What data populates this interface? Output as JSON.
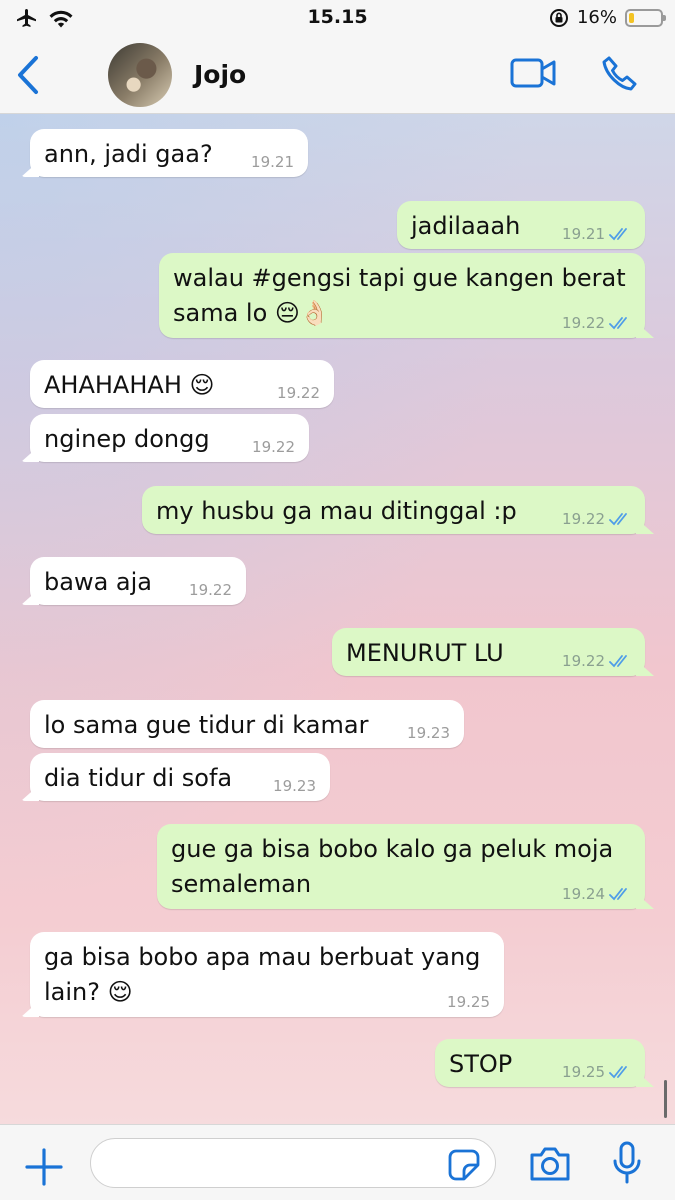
{
  "status_bar": {
    "time": "15.15",
    "battery_percent": "16%",
    "battery_level": 0.16
  },
  "header": {
    "contact_name": "Jojo"
  },
  "messages": [
    {
      "dir": "in",
      "text": "ann, jadi gaa?",
      "time": "19.21"
    },
    {
      "dir": "out",
      "text": "jadilaaah",
      "time": "19.21"
    },
    {
      "dir": "out",
      "text": "walau #gengsi tapi gue kangen berat sama lo 😔👌🏻",
      "time": "19.22"
    },
    {
      "dir": "in",
      "text": "AHAHAHAH 😌",
      "time": "19.22"
    },
    {
      "dir": "in",
      "text": "nginep dongg",
      "time": "19.22"
    },
    {
      "dir": "out",
      "text": "my husbu ga mau ditinggal :p",
      "time": "19.22"
    },
    {
      "dir": "in",
      "text": "bawa aja",
      "time": "19.22"
    },
    {
      "dir": "out",
      "text": "MENURUT LU",
      "time": "19.22"
    },
    {
      "dir": "in",
      "text": "lo sama gue tidur di kamar",
      "time": "19.23"
    },
    {
      "dir": "in",
      "text": "dia tidur di sofa",
      "time": "19.23"
    },
    {
      "dir": "out",
      "text": "gue ga bisa bobo kalo ga peluk moja semaleman",
      "time": "19.24"
    },
    {
      "dir": "in",
      "text": "ga bisa bobo apa mau berbuat yang lain? 😌",
      "time": "19.25"
    },
    {
      "dir": "out",
      "text": "STOP",
      "time": "19.25"
    }
  ],
  "colors": {
    "accent": "#1a73d6",
    "outgoing_bubble": "#dcf8c6",
    "incoming_bubble": "#ffffff",
    "read_ticks": "#4f9de8"
  }
}
